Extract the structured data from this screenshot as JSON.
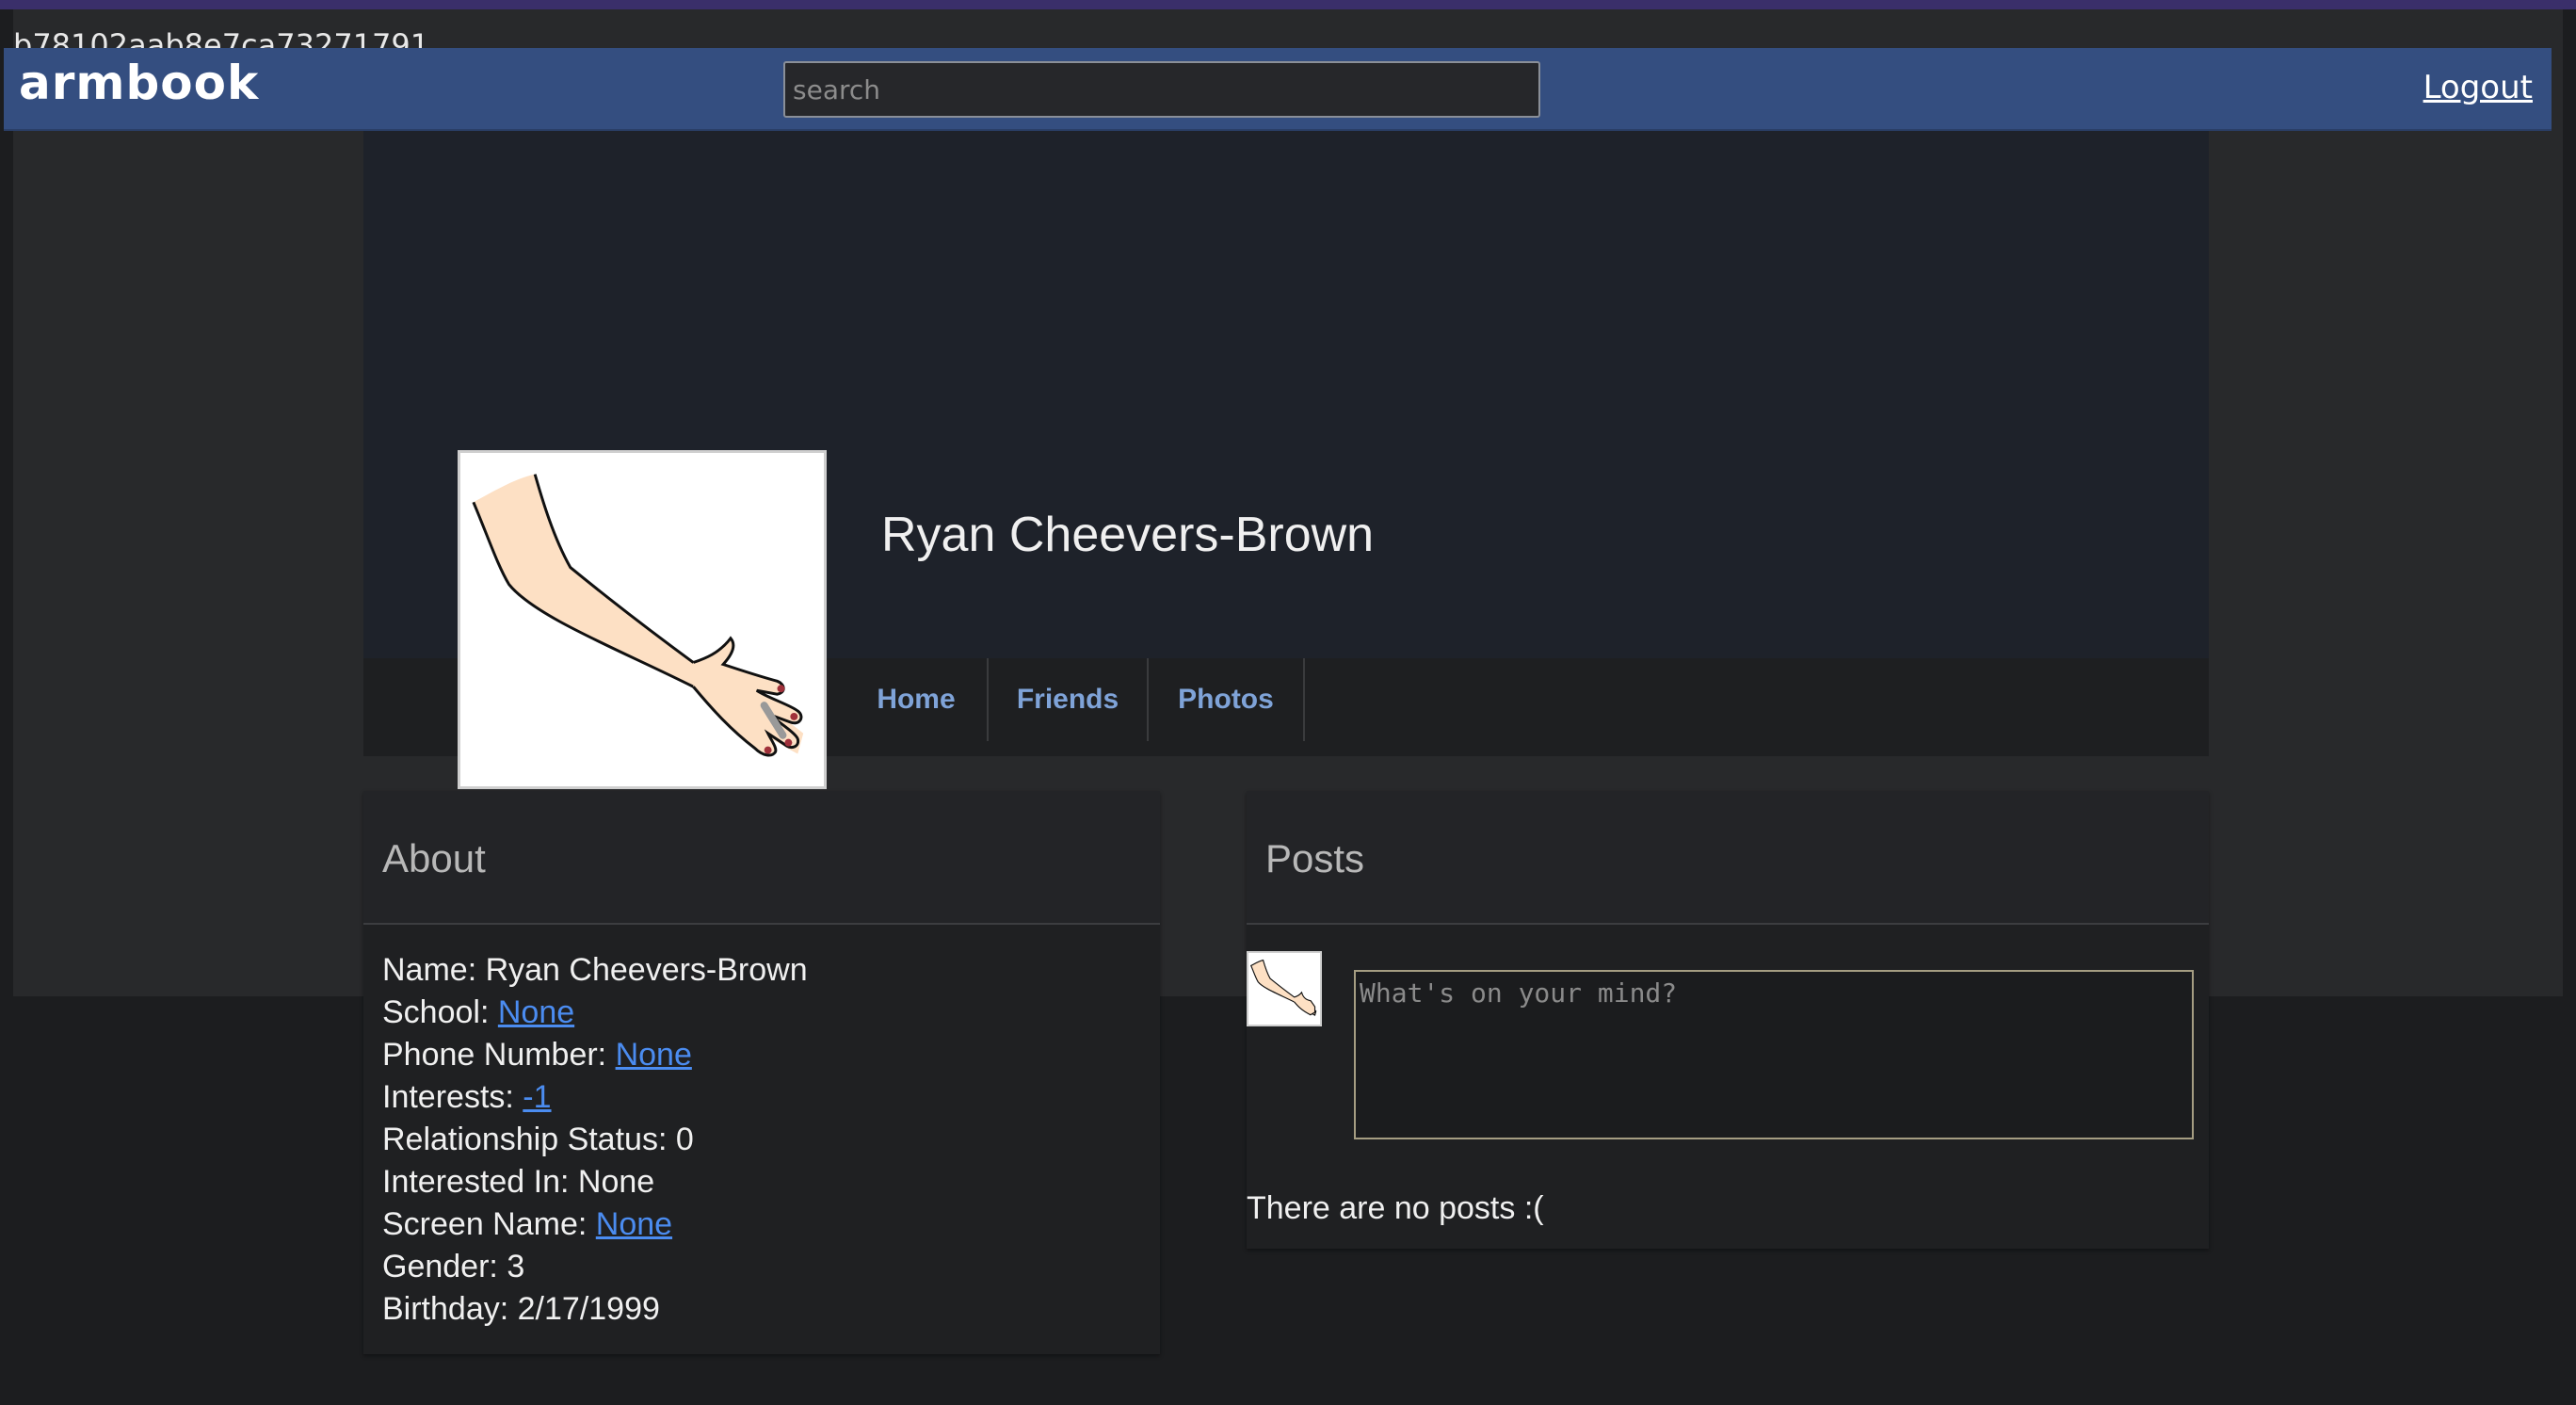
{
  "header": {
    "hash": "b78102aab8e7ca73271791",
    "brand": "armbook",
    "search_placeholder": "search",
    "logout": "Logout"
  },
  "profile": {
    "name": "Ryan Cheevers-Brown",
    "tabs": [
      "Home",
      "Friends",
      "Photos"
    ]
  },
  "about": {
    "title": "About",
    "name_label": "Name:",
    "name_value": "Ryan Cheevers-Brown",
    "school_label": "School:",
    "school_value": "None",
    "phone_label": "Phone Number:",
    "phone_value": "None",
    "interests_label": "Interests:",
    "interests_value": "-1",
    "relationship_label": "Relationship Status:",
    "relationship_value": "0",
    "interested_in_label": "Interested In:",
    "interested_in_value": "None",
    "screen_name_label": "Screen Name:",
    "screen_name_value": "None",
    "gender_label": "Gender:",
    "gender_value": "3",
    "birthday_label": "Birthday:",
    "birthday_value": "2/17/1999"
  },
  "posts": {
    "title": "Posts",
    "placeholder": "What's on your mind?",
    "empty_text": "There are no posts :("
  },
  "colors": {
    "topbar": "#344e80",
    "link": "#4b8cf0",
    "tab_link": "#7fa3d8"
  }
}
